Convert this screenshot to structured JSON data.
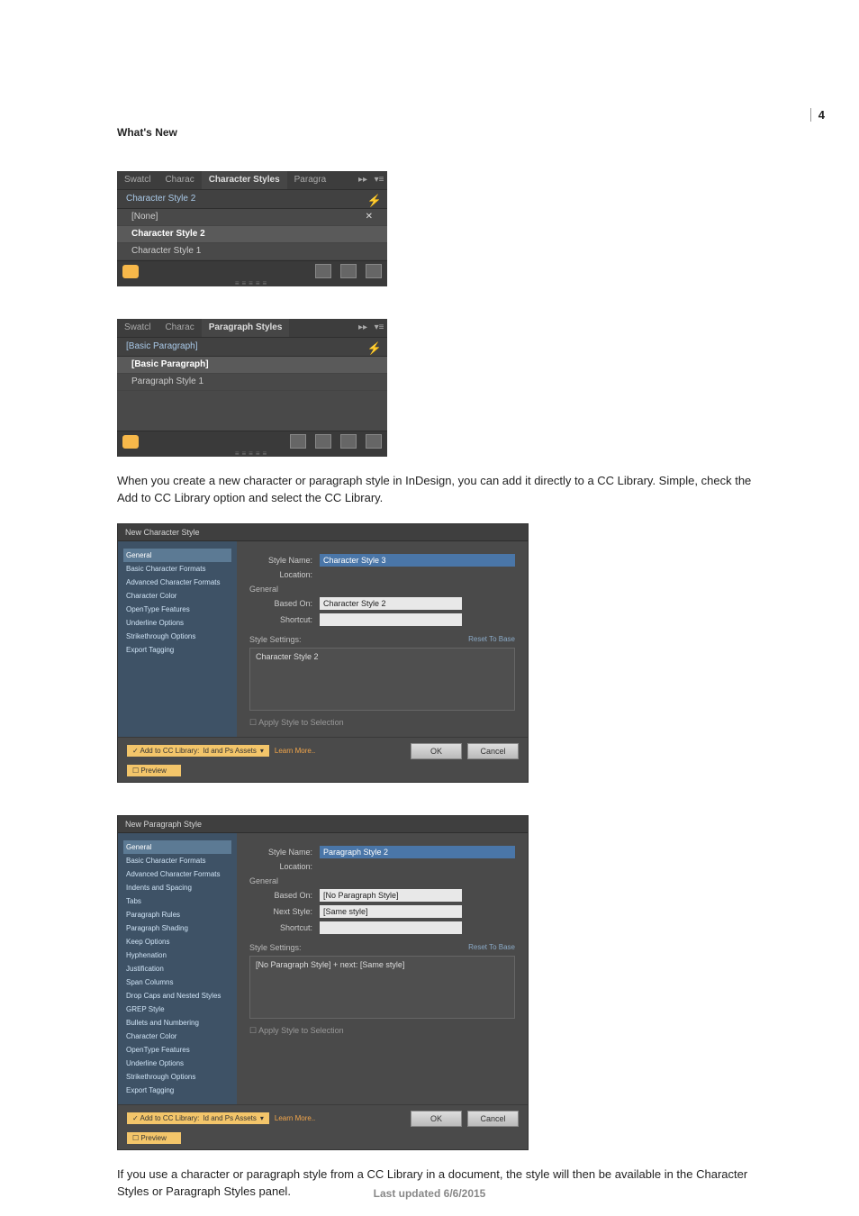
{
  "page_number": "4",
  "section_title": "What's New",
  "body": {
    "p1": "When you create a new character or paragraph style in InDesign, you can add it directly to a CC Library. Simple, check the Add to CC Library option and select the CC Library.",
    "p2": "If you use a character or paragraph style from a CC Library in a document, the style will then be available in the Character Styles or Paragraph Styles panel."
  },
  "footer": "Last updated 6/6/2015",
  "char_panel": {
    "tabs": [
      "Swatcl",
      "Charac",
      "Character Styles",
      "Paragra"
    ],
    "collapse_glyph": "▸▸",
    "menu_glyph": "▾≡",
    "header": "Character Style 2",
    "items": [
      "[None]",
      "Character Style 2",
      "Character Style 1"
    ],
    "footer_icons": [
      "folder-icon",
      "new-style-icon",
      "trash-icon"
    ]
  },
  "para_panel": {
    "tabs": [
      "Swatcl",
      "Charac",
      "Paragraph Styles"
    ],
    "header": "[Basic Paragraph]",
    "items": [
      "[Basic Paragraph]",
      "Paragraph Style 1"
    ],
    "footer_icons": [
      "folder-icon",
      "pilcrow-icon",
      "new-style-icon",
      "trash-icon"
    ]
  },
  "char_dialog": {
    "title": "New Character Style",
    "sidebar": [
      "General",
      "Basic Character Formats",
      "Advanced Character Formats",
      "Character Color",
      "OpenType Features",
      "Underline Options",
      "Strikethrough Options",
      "Export Tagging"
    ],
    "section": "General",
    "style_name_lbl": "Style Name:",
    "style_name": "Character Style 3",
    "location_lbl": "Location:",
    "based_on_lbl": "Based On:",
    "based_on": "Character Style 2",
    "shortcut_lbl": "Shortcut:",
    "settings_lbl": "Style Settings:",
    "reset": "Reset To Base",
    "settings_text": "Character Style 2",
    "apply_chk": "Apply Style to Selection",
    "add_lib": "✓ Add to CC Library:",
    "lib_name": "Id and Ps Assets",
    "learn": "Learn More..",
    "preview": "Preview",
    "ok": "OK",
    "cancel": "Cancel"
  },
  "para_dialog": {
    "title": "New Paragraph Style",
    "sidebar": [
      "General",
      "Basic Character Formats",
      "Advanced Character Formats",
      "Indents and Spacing",
      "Tabs",
      "Paragraph Rules",
      "Paragraph Shading",
      "Keep Options",
      "Hyphenation",
      "Justification",
      "Span Columns",
      "Drop Caps and Nested Styles",
      "GREP Style",
      "Bullets and Numbering",
      "Character Color",
      "OpenType Features",
      "Underline Options",
      "Strikethrough Options",
      "Export Tagging"
    ],
    "section": "General",
    "style_name_lbl": "Style Name:",
    "style_name": "Paragraph Style 2",
    "location_lbl": "Location:",
    "based_on_lbl": "Based On:",
    "based_on": "[No Paragraph Style]",
    "next_lbl": "Next Style:",
    "next": "[Same style]",
    "shortcut_lbl": "Shortcut:",
    "settings_lbl": "Style Settings:",
    "reset": "Reset To Base",
    "settings_text": "[No Paragraph Style] + next: [Same style]",
    "apply_chk": "Apply Style to Selection",
    "add_lib": "✓ Add to CC Library:",
    "lib_name": "Id and Ps Assets",
    "learn": "Learn More..",
    "preview": "Preview",
    "ok": "OK",
    "cancel": "Cancel"
  }
}
